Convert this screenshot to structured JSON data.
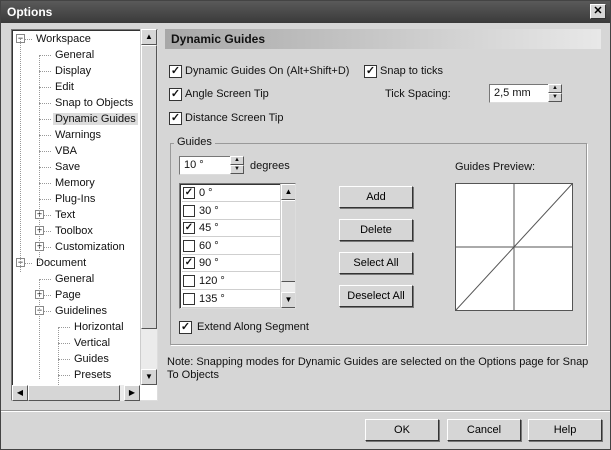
{
  "window": {
    "title": "Options",
    "close_glyph": "✕"
  },
  "tree": {
    "items": [
      {
        "label": "Workspace",
        "expander": "−"
      },
      {
        "label": "General"
      },
      {
        "label": "Display"
      },
      {
        "label": "Edit"
      },
      {
        "label": "Snap to Objects"
      },
      {
        "label": "Dynamic Guides",
        "selected": true
      },
      {
        "label": "Warnings"
      },
      {
        "label": "VBA"
      },
      {
        "label": "Save"
      },
      {
        "label": "Memory"
      },
      {
        "label": "Plug-Ins"
      },
      {
        "label": "Text",
        "expander": "+"
      },
      {
        "label": "Toolbox",
        "expander": "+"
      },
      {
        "label": "Customization",
        "expander": "+"
      },
      {
        "label": "Document",
        "expander": "−"
      },
      {
        "label": "General"
      },
      {
        "label": "Page",
        "expander": "+"
      },
      {
        "label": "Guidelines",
        "expander": "−"
      },
      {
        "label": "Horizontal"
      },
      {
        "label": "Vertical"
      },
      {
        "label": "Guides"
      },
      {
        "label": "Presets"
      }
    ]
  },
  "panel": {
    "title": "Dynamic Guides",
    "dynamic_guides_on": {
      "label": "Dynamic Guides On (Alt+Shift+D)",
      "checked": true
    },
    "snap_to_ticks": {
      "label": "Snap to ticks",
      "checked": true
    },
    "angle_screen_tip": {
      "label": "Angle Screen Tip",
      "checked": true
    },
    "distance_screen_tip": {
      "label": "Distance Screen Tip",
      "checked": true
    },
    "tick_spacing": {
      "label": "Tick Spacing:",
      "value": "2,5 mm"
    },
    "guides": {
      "group_label": "Guides",
      "angle_value": "10 °",
      "degrees_label": "degrees",
      "list": [
        {
          "label": "0 °",
          "checked": true
        },
        {
          "label": "30 °",
          "checked": false
        },
        {
          "label": "45 °",
          "checked": true
        },
        {
          "label": "60 °",
          "checked": false
        },
        {
          "label": "90 °",
          "checked": true
        },
        {
          "label": "120 °",
          "checked": false
        },
        {
          "label": "135 °",
          "checked": false
        }
      ],
      "add": "Add",
      "delete": "Delete",
      "select_all": "Select All",
      "deselect_all": "Deselect All",
      "preview_label": "Guides Preview:",
      "extend_along_segment": {
        "label": "Extend Along Segment",
        "checked": true
      }
    },
    "note": "Note: Snapping modes for Dynamic Guides are selected on the Options page for Snap To Objects"
  },
  "footer": {
    "ok": "OK",
    "cancel": "Cancel",
    "help": "Help"
  },
  "glyphs": {
    "check": "✓",
    "arrow_up": "▲",
    "arrow_down": "▼",
    "arrow_left": "◀",
    "arrow_right": "▶"
  }
}
